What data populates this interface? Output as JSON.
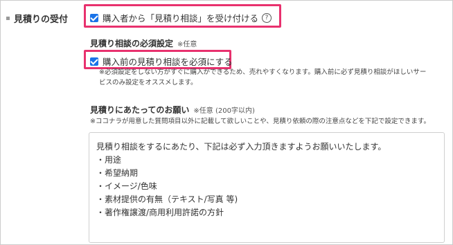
{
  "section": {
    "label": "見積りの受付"
  },
  "accept_quote": {
    "label": "購入者から「見積り相談」を受け付ける",
    "help": "?"
  },
  "required_setting": {
    "heading": "見積り相談の必須設定",
    "optional": "※任意",
    "checkbox_label": "購入前の見積り相談を必須にする",
    "note_line1": "※必須設定をしない方がすぐに購入ができるため、売れやすくなります。購入前に必ず見積り相談がほしいサー",
    "note_line2": "ビスのみ設定をオススメします。"
  },
  "request": {
    "heading": "見積りにあたってのお願い",
    "optional": "※任意 (200字以内)",
    "note": "※ココナラが用意した質問項目以外に記載して欲しいことや、見積り依頼の際の注意点などを下記で設定できます。",
    "textarea_lines": [
      "見積り相談をするにあたり、下記は必ず入力頂きますようお願いいたします。",
      "・用途",
      "・希望納期",
      "・イメージ/色味",
      "・素材提供の有無（テキスト/写真 等)",
      "・著作権譲渡/商用利用許諾の方針"
    ]
  },
  "colors": {
    "highlight": "#e8316e",
    "checkbox": "#1a73e8"
  }
}
